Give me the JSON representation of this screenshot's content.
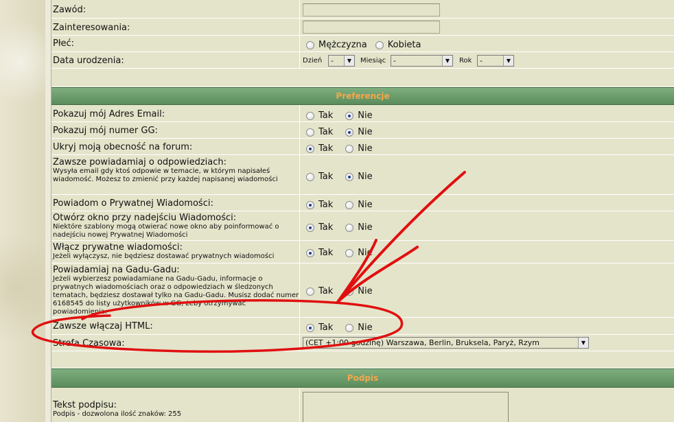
{
  "profile": {
    "zawod_label": "Zawód:",
    "zainteresowania_label": "Zainteresowania:",
    "plec_label": "Płeć:",
    "plec_options": [
      "Mężczyzna",
      "Kobieta"
    ],
    "data_urodzenia_label": "Data urodzenia:",
    "dzien_label": "Dzień",
    "dzien_value": "-",
    "miesiac_label": "Miesiąc",
    "miesiac_value": "-",
    "rok_label": "Rok",
    "rok_value": "-"
  },
  "preferencje": {
    "header": "Preferencje",
    "tak": "Tak",
    "nie": "Nie",
    "rows": [
      {
        "label": "Pokazuj mój Adres Email:",
        "selected": "nie"
      },
      {
        "label": "Pokazuj mój numer GG:",
        "selected": "nie"
      },
      {
        "label": "Ukryj moją obecność na forum:",
        "selected": "tak"
      },
      {
        "label": "Zawsze powiadamiaj o odpowiedziach:",
        "desc": "Wysyła email gdy ktoś odpowie w temacie, w którym napisałeś wiadomość. Możesz to zmienić przy każdej napisanej wiadomości",
        "selected": "nie"
      },
      {
        "label": "Powiadom o Prywatnej Wiadomości:",
        "selected": "tak"
      },
      {
        "label": "Otwórz okno przy nadejściu Wiadomości:",
        "desc": "Niektóre szablony mogą otwierać nowe okno aby poinformować o nadejściu nowej Prywatnej Wiadomości",
        "selected": "tak"
      },
      {
        "label": "Włącz prywatne wiadomości:",
        "desc": "Jeżeli wyłączysz, nie będziesz dostawać prywatnych wiadomości",
        "selected": "tak"
      },
      {
        "label": "Powiadamiaj na Gadu-Gadu:",
        "desc": "Jeżeli wybierzesz powiadamiane na Gadu-Gadu, informacje o prywatnych wiadomościach oraz o odpowiedziach w śledzonych tematach, będziesz dostawał tylko na Gadu-Gadu. Musisz dodać numer 6168545 do listy użytkowników w GG, żeby otrzymywać powiadomienia.",
        "selected": "none"
      },
      {
        "label": "Zawsze włączaj HTML:",
        "selected": "tak"
      }
    ],
    "strefa_label": "Strefa Czasowa:",
    "strefa_value": "(CET +1:00 godzinę) Warszawa, Berlin, Bruksela, Paryż, Rzym"
  },
  "podpis": {
    "header": "Podpis",
    "label": "Tekst podpisu:",
    "desc": "Podpis - dozwolona ilość znaków: 255"
  },
  "colors": {
    "header_green": "#6a9a6a",
    "header_text": "#f5a74a",
    "annotation_red": "#e01010"
  },
  "annotation": {
    "type": "red-ellipse-and-arrows",
    "target": "Zawsze włączaj HTML"
  }
}
